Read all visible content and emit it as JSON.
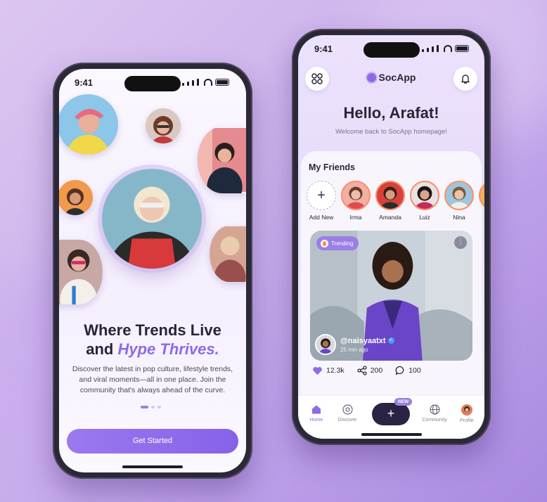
{
  "left_phone": {
    "status_time": "9:41",
    "headline_line1": "Where Trends Live",
    "headline_and": "and ",
    "headline_accent": "Hype Thrives.",
    "description": "Discover the latest in pop culture, lifestyle trends, and viral moments—all in one place. Join the community that's always ahead of the curve.",
    "cta_label": "Get Started",
    "page_index": 0,
    "page_count": 3
  },
  "right_phone": {
    "status_time": "9:41",
    "brand": "SocApp",
    "greeting": "Hello, Arafat!",
    "welcome": "Welcome back to SocApp homepage!",
    "friends_title": "My Friends",
    "add_new": "Add New",
    "friends": [
      {
        "name": "Irma"
      },
      {
        "name": "Amanda"
      },
      {
        "name": "Luiz"
      },
      {
        "name": "Nina"
      }
    ],
    "post": {
      "tag": "Trending",
      "username": "@naisyaatxt",
      "time": "25 min ago",
      "likes": "12.3k",
      "shares": "200",
      "comments": "100"
    },
    "nav": [
      {
        "label": "Home",
        "icon": "home-icon",
        "active": true
      },
      {
        "label": "Discover",
        "icon": "compass-icon"
      },
      {
        "label": "Community",
        "icon": "globe-icon"
      },
      {
        "label": "Profile",
        "icon": "avatar-icon"
      }
    ],
    "new_badge": "NEW"
  },
  "colors": {
    "accent": "#8d6ae6",
    "dark": "#2b2438",
    "background": "#cdb3ec"
  }
}
